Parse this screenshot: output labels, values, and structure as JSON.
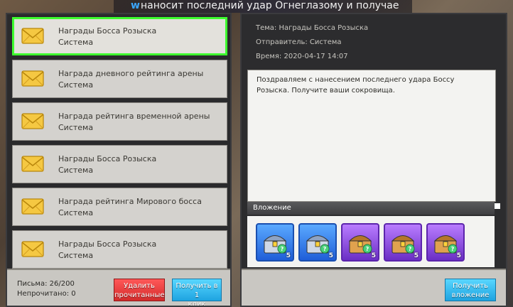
{
  "banner": {
    "prefix": "w",
    "text": "наносит последний удар Огнеглазому и получае"
  },
  "mail_list": [
    {
      "title": "Награды Босса Розыска",
      "sender": "Система",
      "selected": true
    },
    {
      "title": "Награда дневного рейтинга арены",
      "sender": "Система",
      "selected": false
    },
    {
      "title": "Награда рейтинга временной арены",
      "sender": "Система",
      "selected": false
    },
    {
      "title": "Награды Босса Розыска",
      "sender": "Система",
      "selected": false
    },
    {
      "title": "Награда рейтинга Мирового босса",
      "sender": "Система",
      "selected": false
    },
    {
      "title": "Награды Босса Розыска",
      "sender": "Система",
      "selected": false
    }
  ],
  "footer": {
    "letters": "Письма: 26/200",
    "unread": "Непрочитано: 0",
    "delete_label_1": "Удалить",
    "delete_label_2": "прочитанные",
    "collect_all_label_1": "Получить в 1",
    "collect_all_label_2": "клик"
  },
  "detail": {
    "subject": "Тема: Награды Босса Розыска",
    "sender": "Отправитель: Система",
    "time": "Время: 2020-04-17 14:07",
    "body": "Поздравляем с нанесением последнего удара Боссу Розыска. Получите ваши сокровища.",
    "attachments_label": "Вложение",
    "attachments": [
      {
        "icon": "blue-chest-icon",
        "count": "5",
        "color": "blue"
      },
      {
        "icon": "blue-chest-icon",
        "count": "5",
        "color": "blue"
      },
      {
        "icon": "purple-chest-icon",
        "count": "5",
        "color": "purple"
      },
      {
        "icon": "purple-chest-icon",
        "count": "5",
        "color": "purple"
      },
      {
        "icon": "purple-chest-icon",
        "count": "5",
        "color": "purple"
      }
    ],
    "collect_label_1": "Получить",
    "collect_label_2": "вложение"
  },
  "colors": {
    "selected_border": "#3dff2e",
    "delete_button": "#e03a3a",
    "collect_button": "#2bb7ef"
  }
}
